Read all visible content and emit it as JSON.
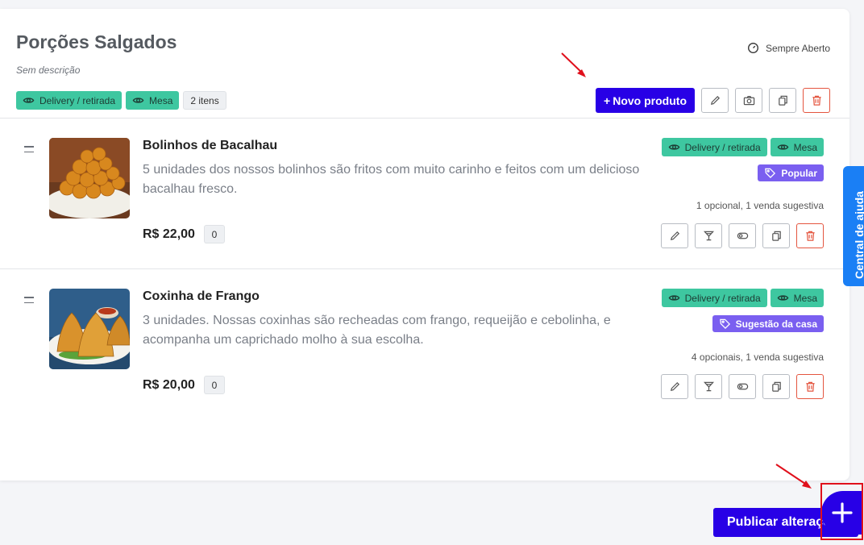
{
  "category": {
    "title": "Porções Salgados",
    "description": "Sem descrição",
    "schedule": "Sempre Aberto",
    "tags": [
      "Delivery / retirada",
      "Mesa"
    ],
    "item_count": "2 itens",
    "new_product_label": "Novo produto"
  },
  "products": [
    {
      "name": "Bolinhos de Bacalhau",
      "description": "5 unidades dos nossos bolinhos são fritos com muito carinho e feitos com um delicioso bacalhau fresco.",
      "price": "R$ 22,00",
      "count": "0",
      "tags": [
        "Delivery / retirada",
        "Mesa"
      ],
      "badge": "Popular",
      "info": "1 opcional, 1 venda sugestiva"
    },
    {
      "name": "Coxinha de Frango",
      "description": "3 unidades. Nossas coxinhas são recheadas com frango, requeijão e cebolinha, e acompanha um caprichado molho à sua escolha.",
      "price": "R$ 20,00",
      "count": "0",
      "tags": [
        "Delivery / retirada",
        "Mesa"
      ],
      "badge": "Sugestão da casa",
      "info": "4 opcionais, 1 venda sugestiva"
    }
  ],
  "help_tab": "Central de ajuda",
  "publish_label": "Publicar alterações",
  "colors": {
    "primary": "#2800e6",
    "tag_green": "#3ec7a0",
    "badge_purple": "#7a5ff0",
    "danger": "#e4553f",
    "help_blue": "#1a7ff5",
    "highlight_red": "#e0101c"
  }
}
